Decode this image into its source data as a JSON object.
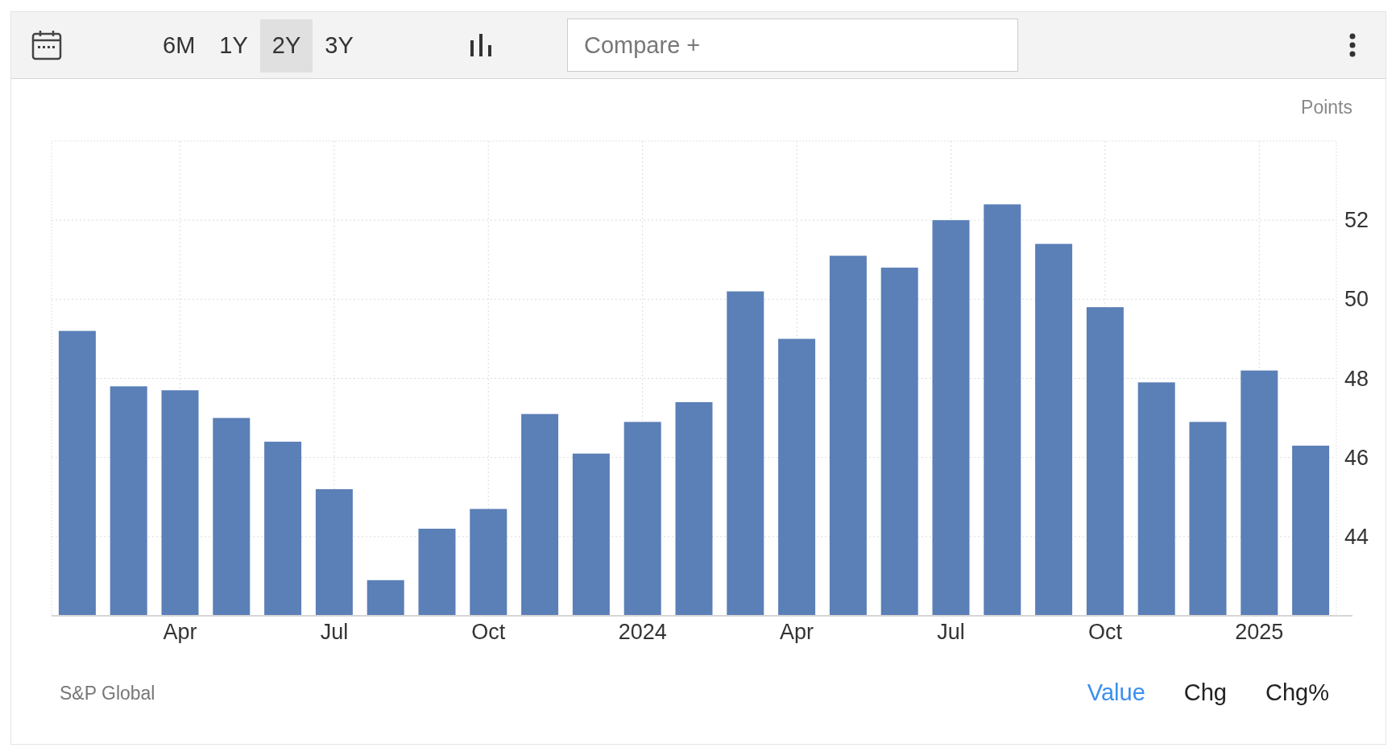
{
  "toolbar": {
    "ranges": [
      {
        "label": "6M",
        "selected": false
      },
      {
        "label": "1Y",
        "selected": false
      },
      {
        "label": "2Y",
        "selected": true
      },
      {
        "label": "3Y",
        "selected": false
      }
    ],
    "compare": {
      "placeholder": "Compare +"
    }
  },
  "chart": {
    "unit": "Points",
    "chart_data": {
      "type": "bar",
      "categories": [
        null,
        null,
        "Apr",
        null,
        null,
        "Jul",
        null,
        null,
        "Oct",
        null,
        null,
        "2024",
        null,
        null,
        "Apr",
        null,
        null,
        "Jul",
        null,
        null,
        "Oct",
        null,
        null,
        "2025",
        null
      ],
      "series": [
        {
          "color": "#5b7fb7",
          "values": [
            49.2,
            47.8,
            47.7,
            47.0,
            46.4,
            45.2,
            42.9,
            44.2,
            44.7,
            47.1,
            46.1,
            46.9,
            47.4,
            50.2,
            49.0,
            51.1,
            50.8,
            52.0,
            52.4,
            51.4,
            49.8,
            47.9,
            46.9,
            48.2,
            46.3
          ]
        }
      ],
      "ylim": [
        42,
        54
      ],
      "yticks": [
        44,
        46,
        48,
        50,
        52
      ],
      "grid": true
    }
  },
  "source": "S&P Global",
  "views": [
    {
      "label": "Value",
      "selected": true
    },
    {
      "label": "Chg",
      "selected": false
    },
    {
      "label": "Chg%",
      "selected": false
    }
  ]
}
